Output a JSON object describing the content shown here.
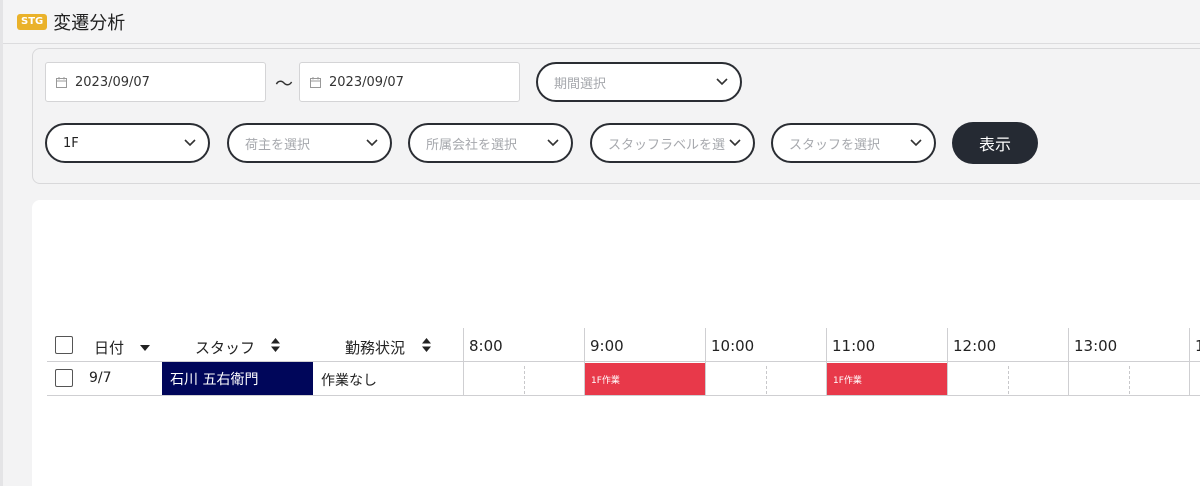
{
  "header": {
    "badge": "STG",
    "title": "変遷分析"
  },
  "filters": {
    "date_from": "2023/09/07",
    "separator": "〜",
    "date_to": "2023/09/07",
    "period_placeholder": "期間選択",
    "floor_value": "1F",
    "shipper_placeholder": "荷主を選択",
    "company_placeholder": "所属会社を選択",
    "staff_label_placeholder": "スタッフラベルを選",
    "staff_placeholder": "スタッフを選択",
    "show_button": "表示"
  },
  "table": {
    "columns": {
      "date": "日付",
      "staff": "スタッフ",
      "status": "勤務状況"
    },
    "hours": [
      "8:00",
      "9:00",
      "10:00",
      "11:00",
      "12:00",
      "13:00",
      "1"
    ],
    "rows": [
      {
        "date": "9/7",
        "staff": "石川 五右衛門",
        "status": "作業なし",
        "tasks": [
          {
            "label": "1F作業",
            "start": "9:00",
            "end": "10:00",
            "color": "#e8394a"
          },
          {
            "label": "1F作業",
            "start": "11:00",
            "end": "12:00",
            "color": "#e8394a"
          }
        ]
      }
    ]
  },
  "colors": {
    "staff_chip": "#00065a",
    "button": "#252a33",
    "badge": "#eab22a"
  }
}
